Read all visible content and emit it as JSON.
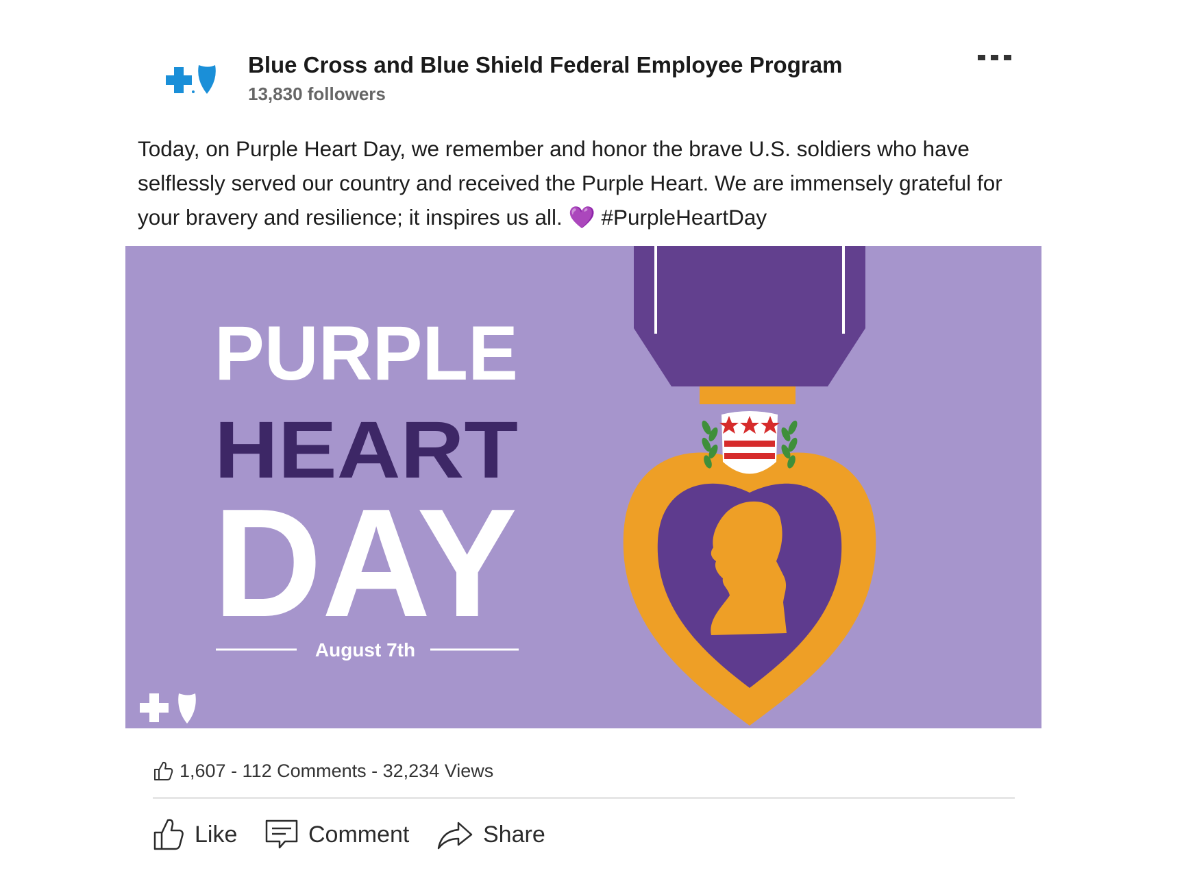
{
  "post": {
    "author": "Blue Cross and Blue Shield Federal Employee Program",
    "followers": "13,830 followers",
    "menu_icon": "more-horizontal-icon",
    "text": "Today, on Purple Heart Day, we remember and honor the brave U.S. soldiers who have selflessly served our country and received the Purple Heart. We are immensely grateful for your bravery and resilience; it inspires us all. 💜 #PurpleHeartDay"
  },
  "image": {
    "title_line1": "PURPLE",
    "title_line2": "HEART",
    "title_line3": "DAY",
    "date": "August 7th",
    "colors": {
      "background": "#a695cc",
      "ribbon": "#62408e",
      "heart": "#5e3b8e",
      "gold": "#ee9f26",
      "dark_text": "#3d2766"
    }
  },
  "stats": {
    "like_icon": "thumbs-up-icon",
    "text": "1,607 - 112 Comments - 32,234 Views"
  },
  "actions": {
    "like": "Like",
    "comment": "Comment",
    "share": "Share"
  }
}
